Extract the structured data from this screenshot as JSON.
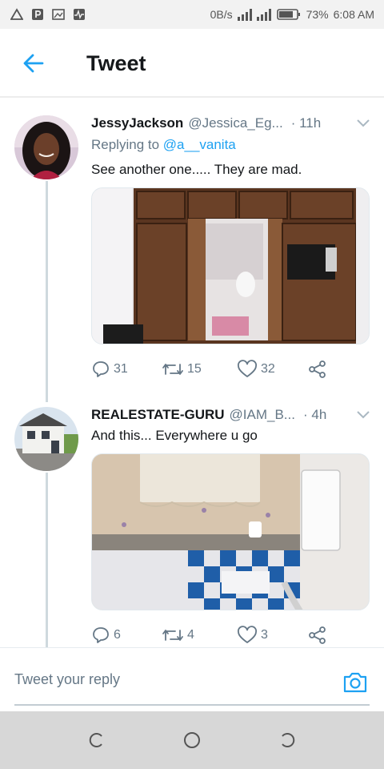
{
  "status_bar": {
    "net_speed": "0B/s",
    "battery": "73%",
    "time": "6:08 AM",
    "icons": [
      "warning-triangle-icon",
      "parking-icon",
      "image-icon",
      "pulse-icon",
      "signal-icon",
      "signal-icon",
      "battery-icon"
    ]
  },
  "header": {
    "title": "Tweet",
    "back_icon": "arrow-left-icon"
  },
  "colors": {
    "accent": "#1da1f2",
    "muted": "#657786",
    "text": "#14171a",
    "thread_line": "#cfd9de"
  },
  "tweets": [
    {
      "name": "JessyJackson",
      "handle": "@Jessica_Eg...",
      "time": "· 11h",
      "replying_prefix": "Replying to ",
      "replying_to": "@a__vanita",
      "text": "See another one..... They are mad.",
      "media_alt": "wardrobe-toilet-photo",
      "counts": {
        "replies": "31",
        "retweets": "15",
        "likes": "32"
      }
    },
    {
      "name": "REALESTATE-GURU",
      "handle": "@IAM_B...",
      "time": "· 4h",
      "text": "And this... Everywhere u go",
      "media_alt": "toilet-cistern-photo",
      "counts": {
        "replies": "6",
        "retweets": "4",
        "likes": "3"
      }
    }
  ],
  "reply_bar": {
    "placeholder": "Tweet your reply"
  }
}
